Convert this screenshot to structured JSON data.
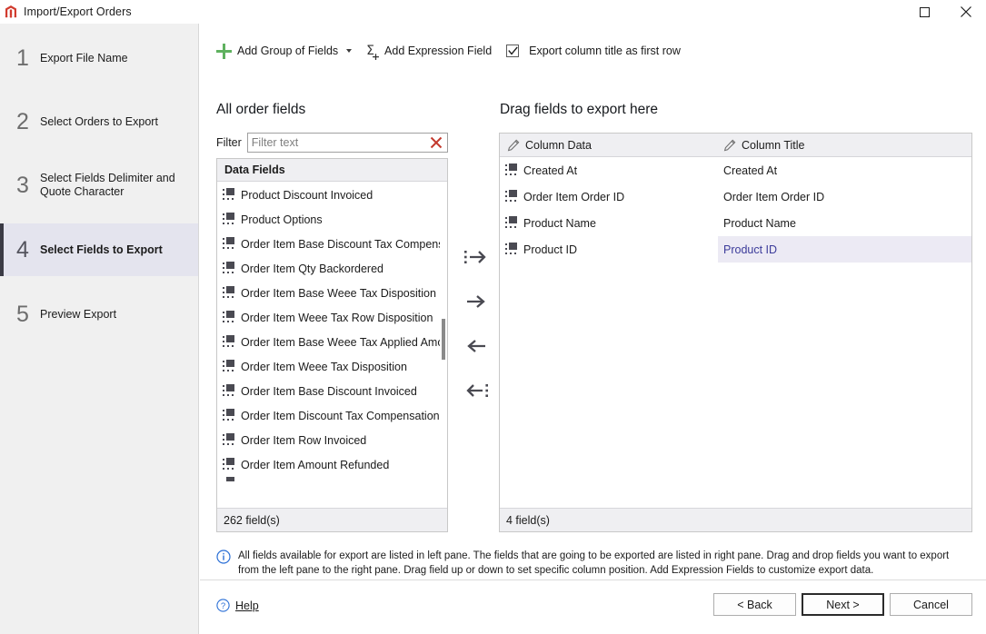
{
  "window": {
    "title": "Import/Export Orders",
    "app_icon": "magento-icon",
    "controls": [
      {
        "name": "maximize-button",
        "icon": "maximize-icon"
      },
      {
        "name": "close-button",
        "icon": "close-icon"
      }
    ]
  },
  "sidebar": {
    "steps": [
      {
        "num": "1",
        "label": "Export File Name",
        "active": false
      },
      {
        "num": "2",
        "label": "Select Orders to Export",
        "active": false
      },
      {
        "num": "3",
        "label": "Select Fields Delimiter and Quote Character",
        "active": false
      },
      {
        "num": "4",
        "label": "Select Fields to Export",
        "active": true
      },
      {
        "num": "5",
        "label": "Preview Export",
        "active": false
      }
    ]
  },
  "toolbar": {
    "add_group_label": "Add Group of Fields",
    "add_group_icon": "plus-icon",
    "add_group_caret": "chevron-down-icon",
    "add_expression_label": "Add Expression Field",
    "add_expression_icon": "sigma-plus-icon",
    "export_title_checkbox_label": "Export column title as first row",
    "export_title_checked": true
  },
  "left_pane": {
    "title": "All order fields",
    "filter_label": "Filter",
    "filter_value": "",
    "filter_placeholder": "Filter text",
    "clear_icon": "clear-x-icon",
    "column_header": "Data Fields",
    "fields": [
      "Product Discount Invoiced",
      "Product Options",
      "Order Item Base Discount Tax Compensation",
      "Order Item Qty Backordered",
      "Order Item Base Weee Tax Disposition",
      "Order Item Weee Tax Row Disposition",
      "Order Item Base Weee Tax Applied Amount",
      "Order Item Weee Tax Disposition",
      "Order Item Base Discount Invoiced",
      "Order Item Discount Tax Compensation Refu",
      "Order Item Row Invoiced",
      "Order Item Amount Refunded"
    ],
    "status": "262 field(s)"
  },
  "transfer_buttons": [
    {
      "name": "move-all-right-button",
      "icon": "dots-arrow-right-icon"
    },
    {
      "name": "move-right-button",
      "icon": "arrow-right-icon"
    },
    {
      "name": "move-left-button",
      "icon": "arrow-left-icon"
    },
    {
      "name": "move-all-left-button",
      "icon": "arrow-left-dots-icon"
    }
  ],
  "right_pane": {
    "title": "Drag fields to export here",
    "headers": {
      "column_data": "Column Data",
      "column_title": "Column Title",
      "icon": "pencil-icon"
    },
    "rows": [
      {
        "data": "Created At",
        "title": "Created At",
        "selected": false
      },
      {
        "data": "Order Item Order ID",
        "title": "Order Item Order ID",
        "selected": false
      },
      {
        "data": "Product Name",
        "title": "Product Name",
        "selected": false
      },
      {
        "data": "Product ID",
        "title": "Product ID",
        "selected": true
      }
    ],
    "status": "4 field(s)"
  },
  "info": {
    "icon": "info-icon",
    "text": "All fields available for export are listed in left pane. The fields that are going to be exported are listed in right pane. Drag and drop fields you want to export from the left pane to the right pane. Drag field up or down to set specific column position. Add Expression Fields to customize export data."
  },
  "footer": {
    "help_label": "Help",
    "help_icon": "question-circle-icon",
    "back_label": "< Back",
    "next_label": "Next >",
    "cancel_label": "Cancel"
  },
  "colors": {
    "accent_green": "#5fb15f",
    "selection": "#eceaf4",
    "selection_text": "#3b3b9a",
    "active_step_bg": "#e4e4ee",
    "active_step_bar": "#3b3b45",
    "clear_red": "#c33a2e",
    "info_blue": "#2a6fd6"
  }
}
